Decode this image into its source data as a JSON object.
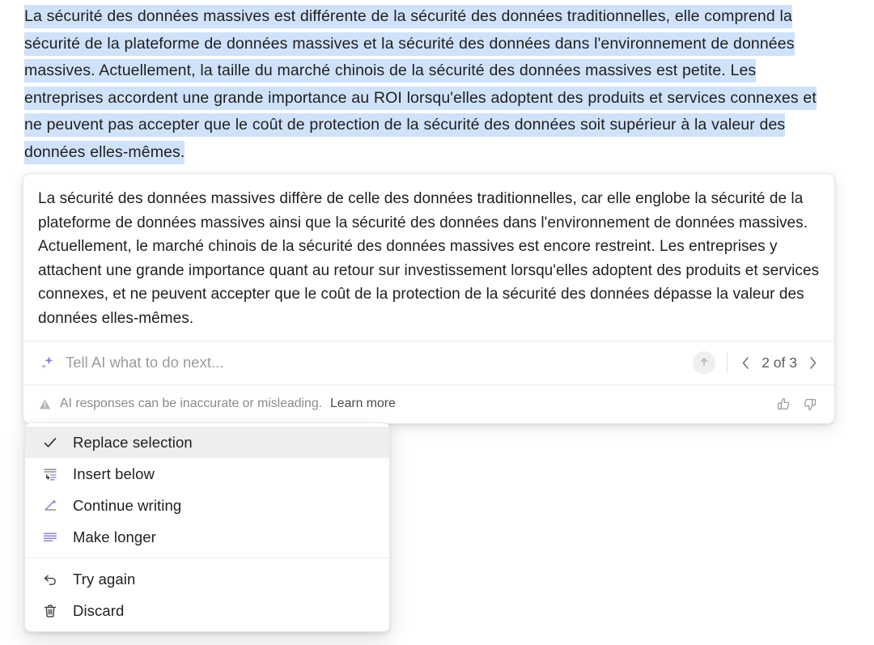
{
  "selection": {
    "highlight_color": "#cfe2f9",
    "text": "La sécurité des données massives est différente de la sécurité des données traditionnelles, elle comprend la sécurité de la plateforme de données massives et la sécurité des données dans l'environnement de données massives. Actuellement, la taille du marché chinois de la sécurité des données massives est petite. Les entreprises accordent une grande importance au ROI lorsqu'elles adoptent des produits et services connexes et ne peuvent pas accepter que le coût de protection de la sécurité des données soit supérieur à la valeur des données elles-mêmes."
  },
  "ai_card": {
    "response_text": "La sécurité des données massives diffère de celle des données traditionnelles, car elle englobe la sécurité de la plateforme de données massives ainsi que la sécurité des données dans l'environnement de données massives. Actuellement, le marché chinois de la sécurité des données massives est encore restreint. Les entreprises y attachent une grande importance quant au retour sur investissement lorsqu'elles adoptent des produits et services connexes, et ne peuvent accepter que le coût de la protection de la sécurité des données dépasse la valeur des données elles-mêmes.",
    "prompt": {
      "placeholder": "Tell AI what to do next...",
      "value": "",
      "sparkle_icon": "sparkle-icon",
      "send_icon": "arrow-up-circle-icon"
    },
    "pagination": {
      "label": "2 of 3",
      "current": 2,
      "total": 3,
      "prev_icon": "chevron-left-icon",
      "next_icon": "chevron-right-icon"
    },
    "disclaimer": {
      "warning_icon": "warning-triangle-icon",
      "text": "AI responses can be inaccurate or misleading.",
      "learn_more": "Learn more",
      "thumbs_up_icon": "thumbs-up-icon",
      "thumbs_down_icon": "thumbs-down-icon"
    }
  },
  "menu": {
    "groups": [
      {
        "items": [
          {
            "label": "Replace selection",
            "icon": "check-icon",
            "active": true
          },
          {
            "label": "Insert below",
            "icon": "insert-below-icon",
            "active": false
          },
          {
            "label": "Continue writing",
            "icon": "pencil-icon",
            "active": false
          },
          {
            "label": "Make longer",
            "icon": "make-longer-icon",
            "active": false
          }
        ]
      },
      {
        "items": [
          {
            "label": "Try again",
            "icon": "undo-arrow-icon",
            "active": false
          },
          {
            "label": "Discard",
            "icon": "trash-icon",
            "active": false
          }
        ]
      }
    ],
    "accent_color": "#8a7fd0"
  }
}
